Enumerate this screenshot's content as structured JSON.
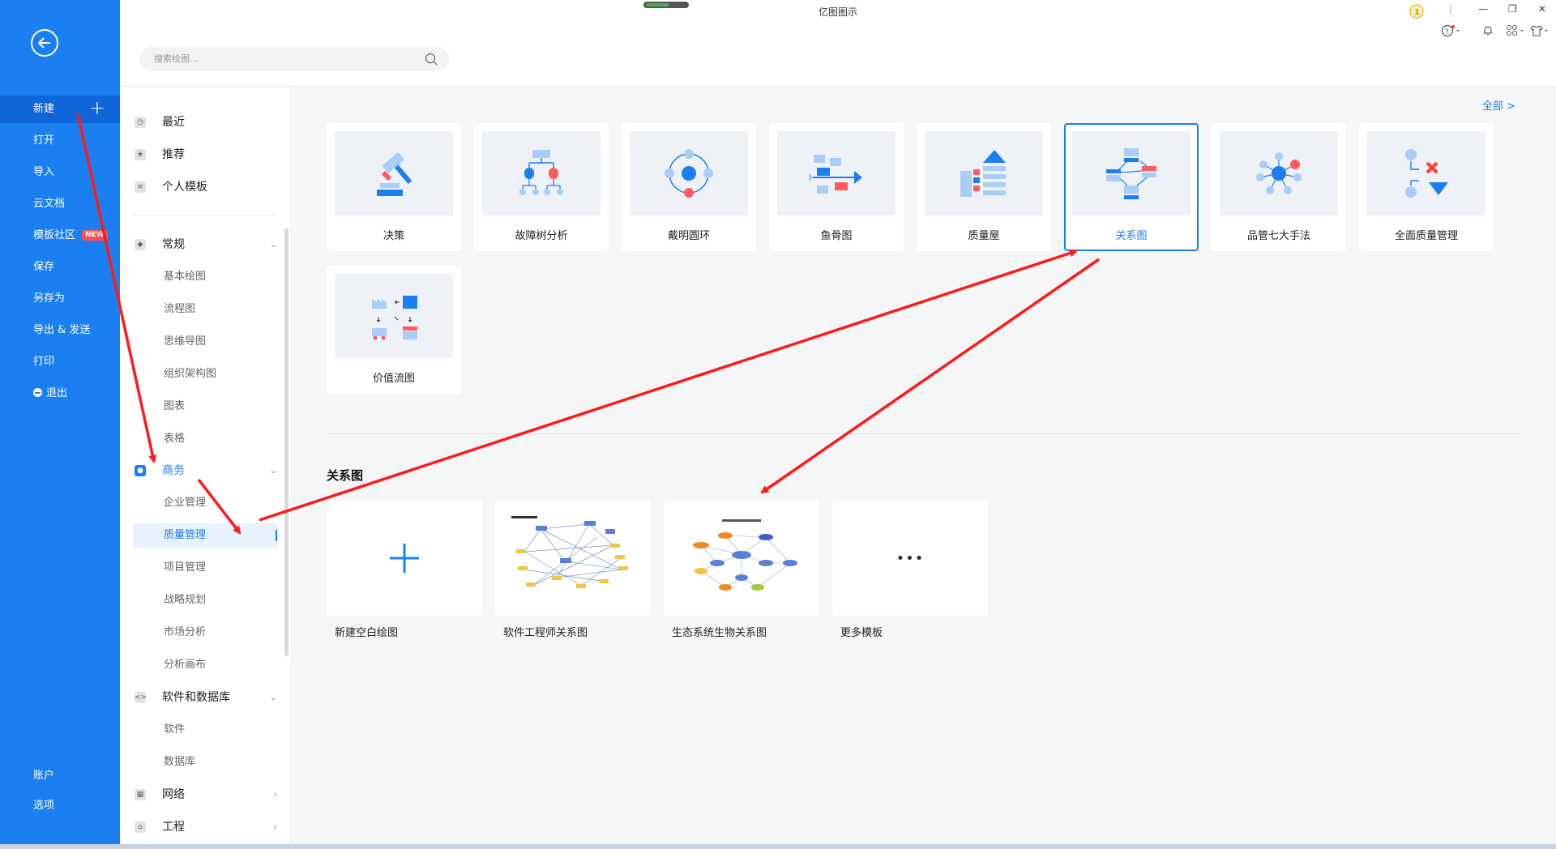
{
  "window": {
    "title": "亿图图示"
  },
  "search": {
    "placeholder": "搜索绘图..."
  },
  "nav": {
    "items": [
      {
        "label": "新建"
      },
      {
        "label": "打开"
      },
      {
        "label": "导入"
      },
      {
        "label": "云文档"
      },
      {
        "label": "模板社区",
        "badge": "NEW"
      },
      {
        "label": "保存"
      },
      {
        "label": "另存为"
      },
      {
        "label": "导出 & 发送"
      },
      {
        "label": "打印"
      },
      {
        "label": "退出"
      }
    ],
    "bottom": [
      {
        "label": "账户"
      },
      {
        "label": "选项"
      }
    ]
  },
  "categories": {
    "top": [
      {
        "label": "最近",
        "icon": "clock-icon"
      },
      {
        "label": "推荐",
        "icon": "star-icon"
      },
      {
        "label": "个人模板",
        "icon": "template-icon"
      }
    ],
    "general": {
      "label": "常规",
      "icon": "tag-icon",
      "children": [
        "基本绘图",
        "流程图",
        "思维导图",
        "组织架构图",
        "图表",
        "表格"
      ]
    },
    "business": {
      "label": "商务",
      "icon": "business-icon",
      "children": [
        "企业管理",
        "质量管理",
        "项目管理",
        "战略规划",
        "市场分析",
        "分析画布"
      ],
      "selected": "质量管理"
    },
    "software": {
      "label": "软件和数据库",
      "icon": "code-icon",
      "children": [
        "软件",
        "数据库"
      ]
    },
    "network": {
      "label": "网络",
      "icon": "network-icon"
    },
    "engineering": {
      "label": "工程",
      "icon": "engineering-icon"
    }
  },
  "main": {
    "all_link": "全部 >",
    "templates": [
      {
        "label": "决策",
        "icon": "gavel-icon"
      },
      {
        "label": "故障树分析",
        "icon": "fault-tree-icon"
      },
      {
        "label": "戴明圆环",
        "icon": "pdca-cycle-icon"
      },
      {
        "label": "鱼骨图",
        "icon": "fishbone-icon"
      },
      {
        "label": "质量屋",
        "icon": "house-of-quality-icon"
      },
      {
        "label": "关系图",
        "icon": "relation-diagram-icon",
        "selected": true
      },
      {
        "label": "品管七大手法",
        "icon": "seven-tools-icon"
      },
      {
        "label": "全面质量管理",
        "icon": "tqm-icon"
      },
      {
        "label": "价值流图",
        "icon": "value-stream-icon"
      }
    ],
    "section_title": "关系图",
    "examples": [
      {
        "label": "新建空白绘图",
        "icon": "plus-icon"
      },
      {
        "label": "软件工程师关系图"
      },
      {
        "label": "生态系统生物关系图"
      },
      {
        "label": "更多模板",
        "icon": "ellipsis-icon"
      }
    ]
  },
  "colors": {
    "accent": "#1a7ff0",
    "annotation": "#ff1a1a"
  }
}
